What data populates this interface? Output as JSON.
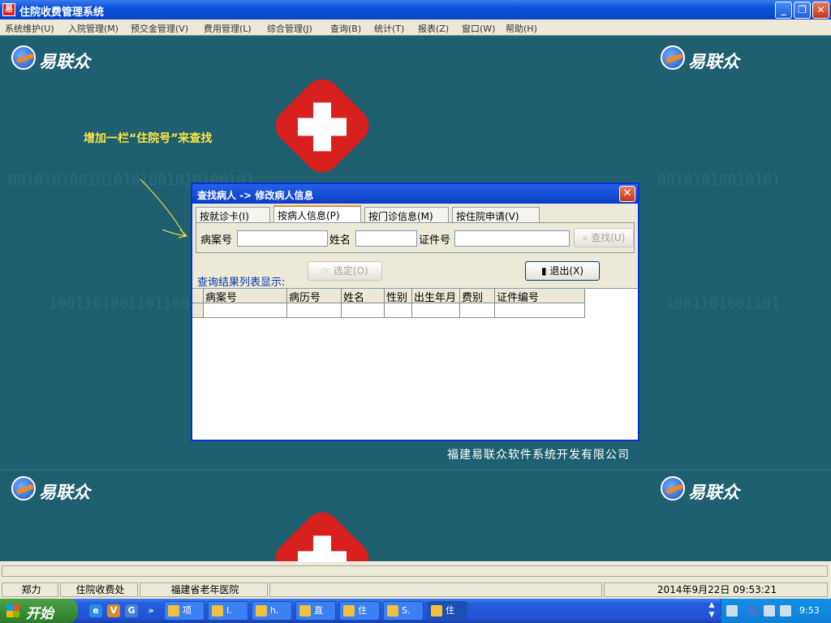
{
  "app": {
    "title": "住院收费管理系统",
    "icon_text": "易"
  },
  "window_buttons": {
    "minimize": "_",
    "restore": "❐",
    "close": "✕"
  },
  "menu": [
    "系统维护(U)",
    "入院管理(M)",
    "预交金管理(V)",
    "费用管理(L)",
    "综合管理(J)",
    "查询(B)",
    "统计(T)",
    "报表(Z)",
    "窗口(W)",
    "帮助(H)"
  ],
  "background": {
    "logo_text": "易联众",
    "annotation": "增加一栏“住院号”来查找",
    "company": "福建易联众软件系统开发有限公司"
  },
  "dialog": {
    "title": "查找病人 -> 修改病人信息",
    "close_label": "✕",
    "tabs": [
      "按就诊卡(I)",
      "按病人信息(P)",
      "按门诊信息(M)",
      "按住院申请(V)"
    ],
    "active_tab": 1,
    "fields": {
      "case_no_label": "病案号",
      "name_label": "姓名",
      "id_label": "证件号"
    },
    "search_button": "查找(U)",
    "result_label": "查询结果列表显示:",
    "select_button": "选定(O)",
    "exit_button": "退出(X)",
    "grid_columns": [
      "病案号",
      "病历号",
      "姓名",
      "性别",
      "出生年月",
      "费别",
      "证件编号"
    ]
  },
  "status": {
    "user": "郑力",
    "dept": "住院收费处",
    "hospital": "福建省老年医院",
    "datetime": "2014年9月22日  09:53:21"
  },
  "taskbar": {
    "start_label": "开始",
    "tasks": [
      "项",
      "I.",
      "h.",
      "直",
      "住",
      "S.",
      "住"
    ],
    "clock": "9:53"
  }
}
